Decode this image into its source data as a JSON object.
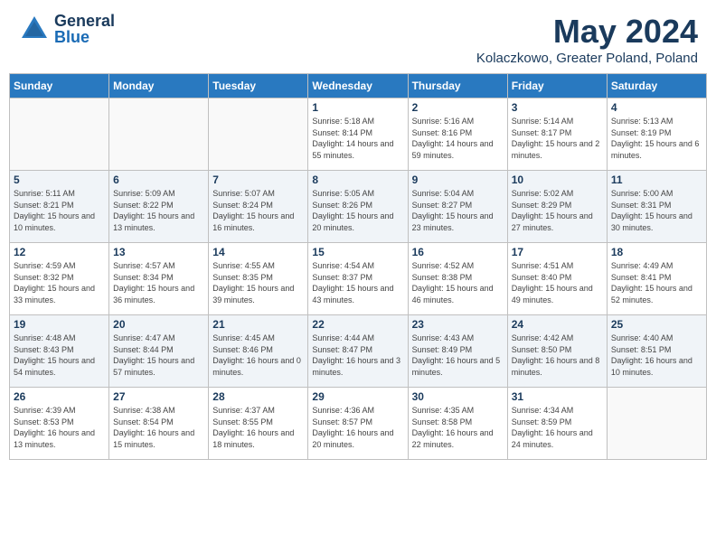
{
  "header": {
    "logo_general": "General",
    "logo_blue": "Blue",
    "month_title": "May 2024",
    "location": "Kolaczkowo, Greater Poland, Poland"
  },
  "weekdays": [
    "Sunday",
    "Monday",
    "Tuesday",
    "Wednesday",
    "Thursday",
    "Friday",
    "Saturday"
  ],
  "weeks": [
    [
      {
        "day": "",
        "sunrise": "",
        "sunset": "",
        "daylight": ""
      },
      {
        "day": "",
        "sunrise": "",
        "sunset": "",
        "daylight": ""
      },
      {
        "day": "",
        "sunrise": "",
        "sunset": "",
        "daylight": ""
      },
      {
        "day": "1",
        "sunrise": "Sunrise: 5:18 AM",
        "sunset": "Sunset: 8:14 PM",
        "daylight": "Daylight: 14 hours and 55 minutes."
      },
      {
        "day": "2",
        "sunrise": "Sunrise: 5:16 AM",
        "sunset": "Sunset: 8:16 PM",
        "daylight": "Daylight: 14 hours and 59 minutes."
      },
      {
        "day": "3",
        "sunrise": "Sunrise: 5:14 AM",
        "sunset": "Sunset: 8:17 PM",
        "daylight": "Daylight: 15 hours and 2 minutes."
      },
      {
        "day": "4",
        "sunrise": "Sunrise: 5:13 AM",
        "sunset": "Sunset: 8:19 PM",
        "daylight": "Daylight: 15 hours and 6 minutes."
      }
    ],
    [
      {
        "day": "5",
        "sunrise": "Sunrise: 5:11 AM",
        "sunset": "Sunset: 8:21 PM",
        "daylight": "Daylight: 15 hours and 10 minutes."
      },
      {
        "day": "6",
        "sunrise": "Sunrise: 5:09 AM",
        "sunset": "Sunset: 8:22 PM",
        "daylight": "Daylight: 15 hours and 13 minutes."
      },
      {
        "day": "7",
        "sunrise": "Sunrise: 5:07 AM",
        "sunset": "Sunset: 8:24 PM",
        "daylight": "Daylight: 15 hours and 16 minutes."
      },
      {
        "day": "8",
        "sunrise": "Sunrise: 5:05 AM",
        "sunset": "Sunset: 8:26 PM",
        "daylight": "Daylight: 15 hours and 20 minutes."
      },
      {
        "day": "9",
        "sunrise": "Sunrise: 5:04 AM",
        "sunset": "Sunset: 8:27 PM",
        "daylight": "Daylight: 15 hours and 23 minutes."
      },
      {
        "day": "10",
        "sunrise": "Sunrise: 5:02 AM",
        "sunset": "Sunset: 8:29 PM",
        "daylight": "Daylight: 15 hours and 27 minutes."
      },
      {
        "day": "11",
        "sunrise": "Sunrise: 5:00 AM",
        "sunset": "Sunset: 8:31 PM",
        "daylight": "Daylight: 15 hours and 30 minutes."
      }
    ],
    [
      {
        "day": "12",
        "sunrise": "Sunrise: 4:59 AM",
        "sunset": "Sunset: 8:32 PM",
        "daylight": "Daylight: 15 hours and 33 minutes."
      },
      {
        "day": "13",
        "sunrise": "Sunrise: 4:57 AM",
        "sunset": "Sunset: 8:34 PM",
        "daylight": "Daylight: 15 hours and 36 minutes."
      },
      {
        "day": "14",
        "sunrise": "Sunrise: 4:55 AM",
        "sunset": "Sunset: 8:35 PM",
        "daylight": "Daylight: 15 hours and 39 minutes."
      },
      {
        "day": "15",
        "sunrise": "Sunrise: 4:54 AM",
        "sunset": "Sunset: 8:37 PM",
        "daylight": "Daylight: 15 hours and 43 minutes."
      },
      {
        "day": "16",
        "sunrise": "Sunrise: 4:52 AM",
        "sunset": "Sunset: 8:38 PM",
        "daylight": "Daylight: 15 hours and 46 minutes."
      },
      {
        "day": "17",
        "sunrise": "Sunrise: 4:51 AM",
        "sunset": "Sunset: 8:40 PM",
        "daylight": "Daylight: 15 hours and 49 minutes."
      },
      {
        "day": "18",
        "sunrise": "Sunrise: 4:49 AM",
        "sunset": "Sunset: 8:41 PM",
        "daylight": "Daylight: 15 hours and 52 minutes."
      }
    ],
    [
      {
        "day": "19",
        "sunrise": "Sunrise: 4:48 AM",
        "sunset": "Sunset: 8:43 PM",
        "daylight": "Daylight: 15 hours and 54 minutes."
      },
      {
        "day": "20",
        "sunrise": "Sunrise: 4:47 AM",
        "sunset": "Sunset: 8:44 PM",
        "daylight": "Daylight: 15 hours and 57 minutes."
      },
      {
        "day": "21",
        "sunrise": "Sunrise: 4:45 AM",
        "sunset": "Sunset: 8:46 PM",
        "daylight": "Daylight: 16 hours and 0 minutes."
      },
      {
        "day": "22",
        "sunrise": "Sunrise: 4:44 AM",
        "sunset": "Sunset: 8:47 PM",
        "daylight": "Daylight: 16 hours and 3 minutes."
      },
      {
        "day": "23",
        "sunrise": "Sunrise: 4:43 AM",
        "sunset": "Sunset: 8:49 PM",
        "daylight": "Daylight: 16 hours and 5 minutes."
      },
      {
        "day": "24",
        "sunrise": "Sunrise: 4:42 AM",
        "sunset": "Sunset: 8:50 PM",
        "daylight": "Daylight: 16 hours and 8 minutes."
      },
      {
        "day": "25",
        "sunrise": "Sunrise: 4:40 AM",
        "sunset": "Sunset: 8:51 PM",
        "daylight": "Daylight: 16 hours and 10 minutes."
      }
    ],
    [
      {
        "day": "26",
        "sunrise": "Sunrise: 4:39 AM",
        "sunset": "Sunset: 8:53 PM",
        "daylight": "Daylight: 16 hours and 13 minutes."
      },
      {
        "day": "27",
        "sunrise": "Sunrise: 4:38 AM",
        "sunset": "Sunset: 8:54 PM",
        "daylight": "Daylight: 16 hours and 15 minutes."
      },
      {
        "day": "28",
        "sunrise": "Sunrise: 4:37 AM",
        "sunset": "Sunset: 8:55 PM",
        "daylight": "Daylight: 16 hours and 18 minutes."
      },
      {
        "day": "29",
        "sunrise": "Sunrise: 4:36 AM",
        "sunset": "Sunset: 8:57 PM",
        "daylight": "Daylight: 16 hours and 20 minutes."
      },
      {
        "day": "30",
        "sunrise": "Sunrise: 4:35 AM",
        "sunset": "Sunset: 8:58 PM",
        "daylight": "Daylight: 16 hours and 22 minutes."
      },
      {
        "day": "31",
        "sunrise": "Sunrise: 4:34 AM",
        "sunset": "Sunset: 8:59 PM",
        "daylight": "Daylight: 16 hours and 24 minutes."
      },
      {
        "day": "",
        "sunrise": "",
        "sunset": "",
        "daylight": ""
      }
    ]
  ]
}
